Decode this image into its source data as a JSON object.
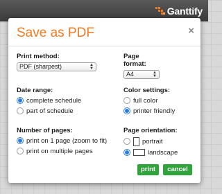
{
  "app": {
    "logo_text": "Ganttify",
    "brand_color": "#f07a22",
    "accent_color": "#2b7be0",
    "button_color": "#2fa43a"
  },
  "dialog": {
    "title": "Save as PDF",
    "close_icon": "×",
    "print_method": {
      "label": "Print method:",
      "value": "PDF (sharpest)"
    },
    "page_format": {
      "label": "Page format:",
      "value": "A4"
    },
    "date_range": {
      "label": "Date range:",
      "options": [
        {
          "label": "complete schedule",
          "selected": true
        },
        {
          "label": "part of schedule",
          "selected": false
        }
      ]
    },
    "color_settings": {
      "label": "Color settings:",
      "options": [
        {
          "label": "full color",
          "selected": false
        },
        {
          "label": "printer friendly",
          "selected": true
        }
      ]
    },
    "pages": {
      "label": "Number of pages:",
      "options": [
        {
          "label": "print on 1 page (zoom to fit)",
          "selected": true
        },
        {
          "label": "print on multiple pages",
          "selected": false
        }
      ]
    },
    "orientation": {
      "label": "Page orientation:",
      "options": [
        {
          "label": "portrait",
          "selected": false,
          "icon": "portrait-page-icon"
        },
        {
          "label": "landscape",
          "selected": true,
          "icon": "landscape-page-icon"
        }
      ]
    },
    "buttons": {
      "print": "print",
      "cancel": "cancel"
    }
  }
}
